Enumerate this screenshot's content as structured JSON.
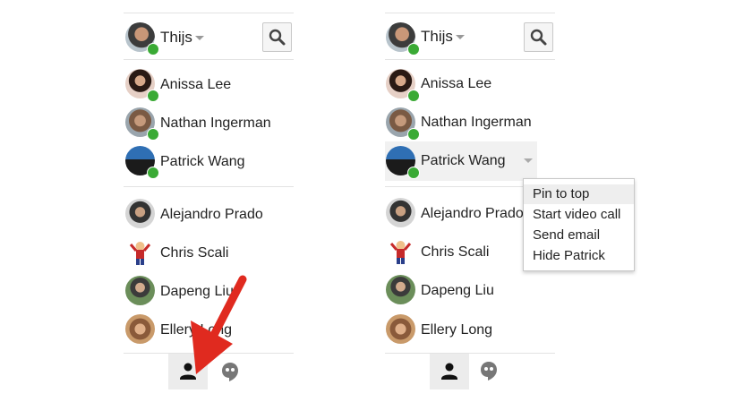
{
  "left": {
    "user": {
      "name": "Thijs"
    },
    "online_contacts": [
      {
        "name": "Anissa Lee"
      },
      {
        "name": "Nathan Ingerman"
      },
      {
        "name": "Patrick Wang"
      }
    ],
    "other_contacts": [
      {
        "name": "Alejandro Prado"
      },
      {
        "name": "Chris Scali"
      },
      {
        "name": "Dapeng Liu"
      },
      {
        "name": "Ellery Long"
      }
    ]
  },
  "right": {
    "user": {
      "name": "Thijs"
    },
    "online_contacts": [
      {
        "name": "Anissa Lee"
      },
      {
        "name": "Nathan Ingerman"
      },
      {
        "name": "Patrick Wang"
      }
    ],
    "other_contacts": [
      {
        "name": "Alejandro Prado"
      },
      {
        "name": "Chris Scali"
      },
      {
        "name": "Dapeng Liu"
      },
      {
        "name": "Ellery Long"
      }
    ],
    "context_menu": {
      "items": [
        {
          "label": "Pin to top"
        },
        {
          "label": "Start video call"
        },
        {
          "label": "Send email"
        },
        {
          "label": "Hide Patrick"
        }
      ]
    }
  },
  "colors": {
    "presence": "#3aaa35",
    "annotation_arrow": "#e02a1f"
  },
  "icons": [
    "search-icon",
    "person-icon",
    "hangouts-quote-icon",
    "caret-down-icon"
  ]
}
